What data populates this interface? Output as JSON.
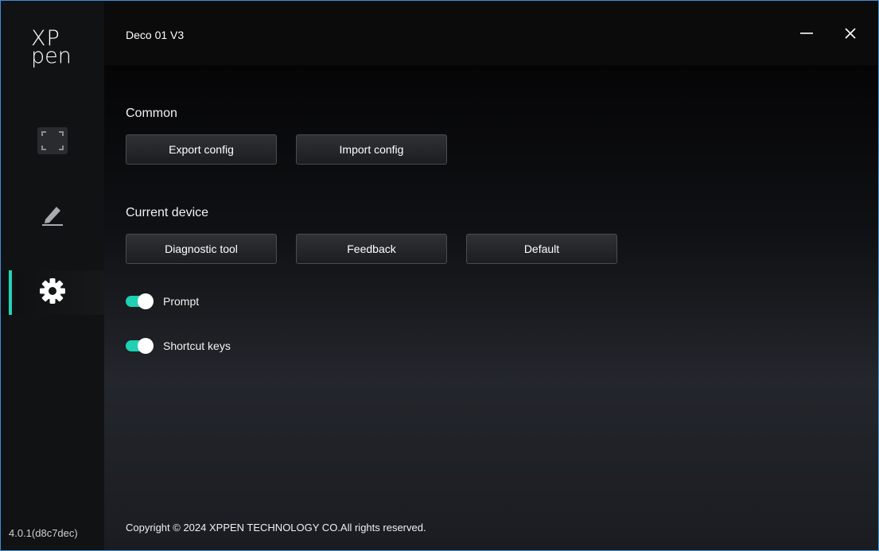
{
  "app": {
    "logo_line1": "XP",
    "logo_line2": "pen",
    "title": "Deco 01 V3",
    "version": "4.0.1(d8c7dec)",
    "accent_color": "#22d3b5"
  },
  "sidebar": {
    "items": [
      {
        "name": "work-area",
        "icon": "screen-frame-icon",
        "active": false
      },
      {
        "name": "pen",
        "icon": "pen-icon",
        "active": false
      },
      {
        "name": "settings",
        "icon": "gear-icon",
        "active": true
      }
    ]
  },
  "window_controls": {
    "minimize_icon": "minimize-icon",
    "close_icon": "close-icon"
  },
  "common": {
    "heading": "Common",
    "export_label": "Export config",
    "import_label": "Import config"
  },
  "current_device": {
    "heading": "Current device",
    "diagnostic_label": "Diagnostic tool",
    "feedback_label": "Feedback",
    "default_label": "Default"
  },
  "toggles": {
    "prompt_label": "Prompt",
    "prompt_on": true,
    "shortcut_label": "Shortcut keys",
    "shortcut_on": true
  },
  "footer": {
    "copyright": "Copyright © 2024  XPPEN TECHNOLOGY CO.All rights reserved."
  }
}
